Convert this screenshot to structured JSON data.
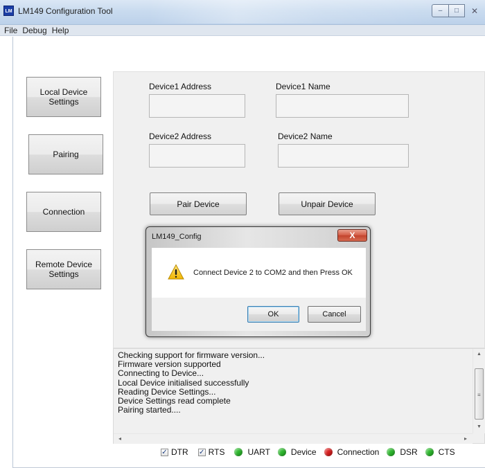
{
  "window": {
    "icon_text": "LM",
    "title": "LM149 Configuration Tool",
    "minimize_glyph": "–",
    "maximize_glyph": "□",
    "close_glyph": "✕"
  },
  "menu": [
    "File",
    "Debug",
    "Help"
  ],
  "nav": {
    "local_device_settings": "Local Device\nSettings",
    "pairing": "Pairing",
    "connection": "Connection",
    "remote_device_settings": "Remote Device\nSettings"
  },
  "form": {
    "device1_address_label": "Device1 Address",
    "device1_address_value": "",
    "device1_name_label": "Device1 Name",
    "device1_name_value": "",
    "device2_address_label": "Device2 Address",
    "device2_address_value": "",
    "device2_name_label": "Device2 Name",
    "device2_name_value": "",
    "pair_device_label": "Pair Device",
    "unpair_device_label": "Unpair Device"
  },
  "dialog": {
    "title": "LM149_Config",
    "close_glyph": "X",
    "icon": "warning-icon",
    "message": "Connect Device 2 to COM2 and then Press OK",
    "ok_label": "OK",
    "cancel_label": "Cancel"
  },
  "log": {
    "lines": [
      "Checking support for firmware version...",
      "Firmware version supported",
      "Connecting to Device...",
      "Local Device initialised successfully",
      "Reading Device Settings...",
      "Device Settings read complete",
      "Pairing started...."
    ]
  },
  "status": {
    "checkboxes": [
      {
        "label": "DTR",
        "checked": true
      },
      {
        "label": "RTS",
        "checked": true
      }
    ],
    "leds": [
      {
        "label": "UART",
        "color": "#2db82d"
      },
      {
        "label": "Device",
        "color": "#2db82d"
      },
      {
        "label": "Connection",
        "color": "#d91f1f"
      },
      {
        "label": "DSR",
        "color": "#2db82d"
      },
      {
        "label": "CTS",
        "color": "#2db82d"
      }
    ]
  }
}
